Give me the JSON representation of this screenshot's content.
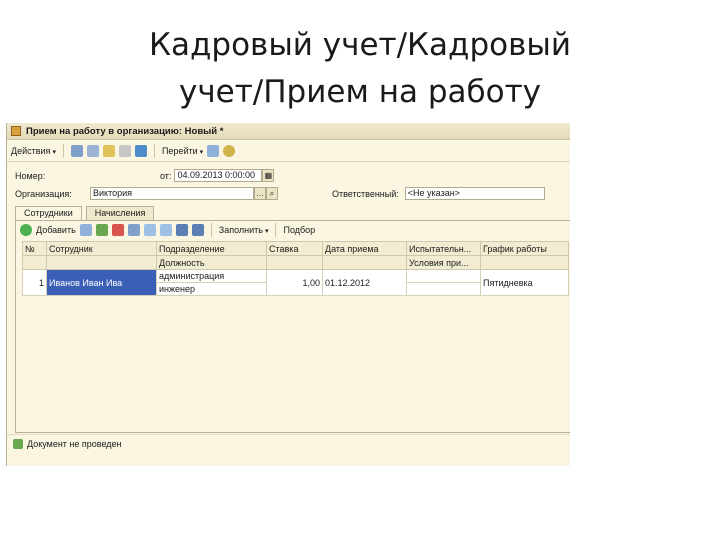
{
  "slide": {
    "title_line1": "Кадровый учет/Кадровый",
    "title_line2": "учет/Прием на работу"
  },
  "window": {
    "title": "Прием на работу в организацию: Новый *"
  },
  "toolbar": {
    "actions_label": "Действия",
    "goto_label": "Перейти"
  },
  "form": {
    "number_label": "Номер:",
    "number_value": "",
    "from_label": "от:",
    "date_value": "04.09.2013  0:00:00",
    "org_label": "Организация:",
    "org_value": "Виктория",
    "responsible_label": "Ответственный:",
    "responsible_value": "<Не указан>"
  },
  "tabs": [
    {
      "label": "Сотрудники"
    },
    {
      "label": "Начисления"
    }
  ],
  "table_toolbar": {
    "add_label": "Добавить",
    "fill_label": "Заполнить",
    "pick_label": "Подбор"
  },
  "table": {
    "headers_top": [
      "№",
      "Сотрудник",
      "Подразделение",
      "Ставка",
      "Дата приема",
      "Испытательн...",
      "График работы"
    ],
    "headers_bottom": [
      "",
      "",
      "Должность",
      "",
      "",
      "Условия при...",
      ""
    ],
    "rows": [
      {
        "num": "1",
        "employee": "Иванов Иван Ива",
        "department": "администрация",
        "position": "инженер",
        "rate": "1,00",
        "hire_date": "01.12.2012",
        "trial": "",
        "conditions": "",
        "schedule": "Пятидневка"
      }
    ]
  },
  "status": {
    "text": "Документ не проведен"
  },
  "colors": {
    "window_bg": "#fbf6e2",
    "selection": "#3b5fb7"
  }
}
